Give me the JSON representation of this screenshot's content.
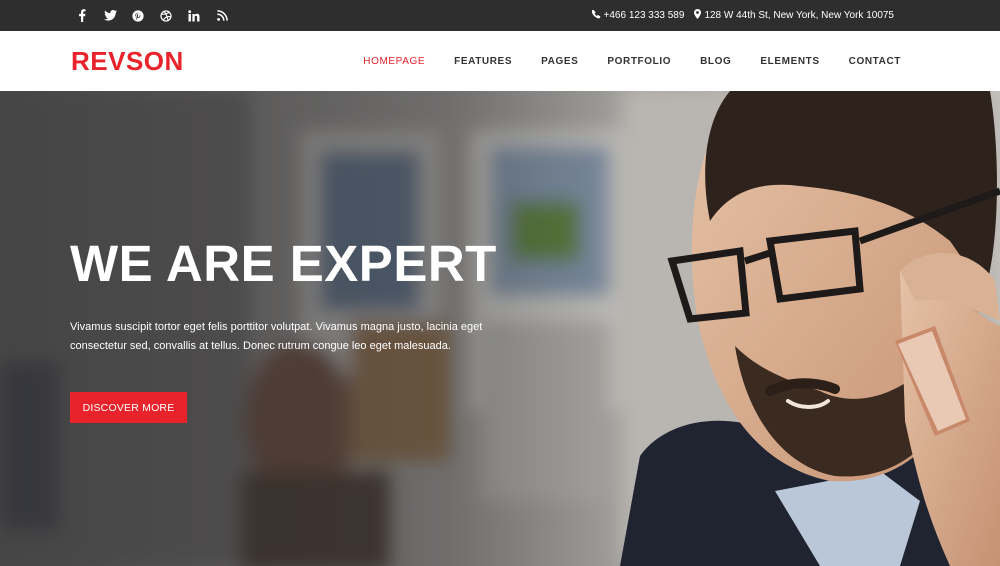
{
  "colors": {
    "accent": "#e8232b",
    "topbar_bg": "#2e2e2e",
    "nav_bg": "#ffffff",
    "nav_text": "#333333"
  },
  "topbar": {
    "social_icons": [
      "facebook-icon",
      "twitter-icon",
      "pinterest-icon",
      "dribbble-icon",
      "linkedin-icon",
      "rss-icon"
    ],
    "phone": "+466 123 333 589",
    "address": "128 W 44th St, New York, New York 10075"
  },
  "nav": {
    "logo": "REVSON",
    "items": [
      {
        "label": "HOMEPAGE",
        "active": true
      },
      {
        "label": "FEATURES",
        "active": false
      },
      {
        "label": "PAGES",
        "active": false
      },
      {
        "label": "PORTFOLIO",
        "active": false
      },
      {
        "label": "BLOG",
        "active": false
      },
      {
        "label": "ELEMENTS",
        "active": false
      },
      {
        "label": "CONTACT",
        "active": false
      }
    ]
  },
  "hero": {
    "title": "WE ARE EXPERT",
    "text": "Vivamus suscipit tortor eget felis porttitor volutpat. Vivamus magna justo, lacinia eget consectetur sed, convallis at tellus. Donec rutrum congue leo eget malesuada.",
    "button_label": "DISCOVER MORE"
  }
}
